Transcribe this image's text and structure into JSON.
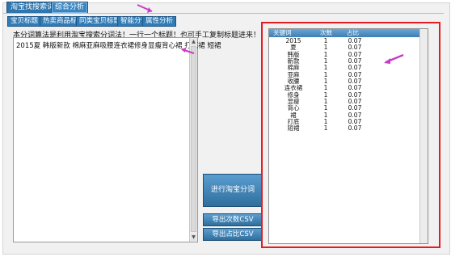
{
  "tabs": [
    {
      "label": "淘宝找搜索词"
    },
    {
      "label": "综合分析"
    }
  ],
  "toolbar": [
    {
      "label": "宝贝标题"
    },
    {
      "label": "热卖商品标题"
    },
    {
      "label": "同类宝贝标题"
    },
    {
      "label": "智能分词"
    },
    {
      "label": "属性分析"
    }
  ],
  "note": "本分词算法是利用淘宝搜索分词法！一行一个标题！也可手工复制标题进来！",
  "input_text": "2015夏 韩版新款 棉麻亚麻吸腰连衣裙修身显瘦背心裙 打底裙 短裙",
  "buttons": {
    "analyze": "进行淘宝分词",
    "export_count": "导出次数CSV",
    "export_ratio": "导出占比CSV"
  },
  "result_table": {
    "headers": [
      "关键词",
      "次数",
      "占比"
    ],
    "rows": [
      [
        "2015",
        "1",
        "0.07"
      ],
      [
        "夏",
        "1",
        "0.07"
      ],
      [
        "韩版",
        "1",
        "0.07"
      ],
      [
        "新款",
        "1",
        "0.07"
      ],
      [
        "棉麻",
        "1",
        "0.07"
      ],
      [
        "亚麻",
        "1",
        "0.07"
      ],
      [
        "收腰",
        "1",
        "0.07"
      ],
      [
        "连衣裙",
        "1",
        "0.07"
      ],
      [
        "修身",
        "1",
        "0.07"
      ],
      [
        "显瘦",
        "1",
        "0.07"
      ],
      [
        "背心",
        "1",
        "0.07"
      ],
      [
        "裙",
        "1",
        "0.07"
      ],
      [
        "打底",
        "1",
        "0.07"
      ],
      [
        "短裙",
        "1",
        "0.07"
      ]
    ]
  },
  "colors": {
    "tab_blue": "#2e76ad",
    "highlight_red": "#e51c23",
    "annotation_pink": "#c83cc6"
  }
}
